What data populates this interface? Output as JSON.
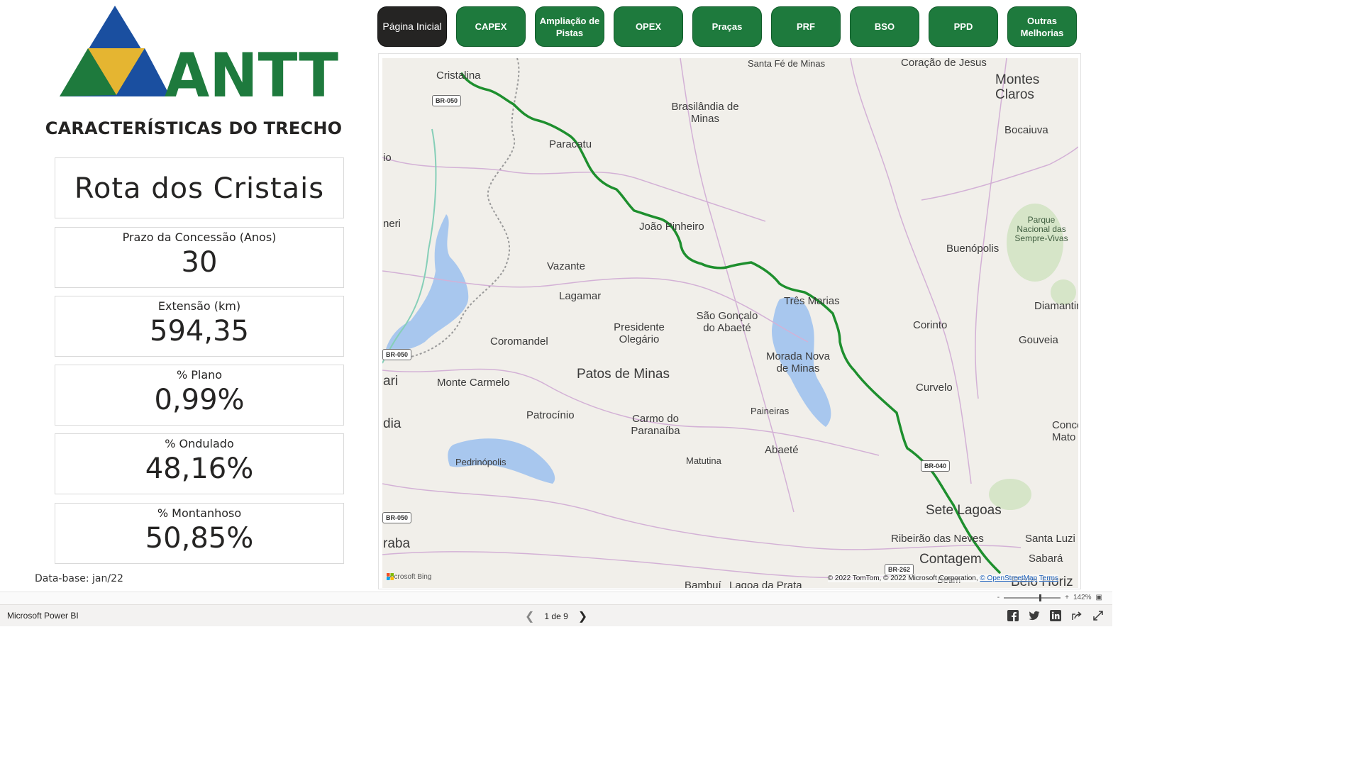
{
  "logo": {
    "text": "ANTT",
    "colors": {
      "blue": "#1a4fa0",
      "yellow": "#e5b531",
      "green": "#1e7a3d"
    }
  },
  "section_title": "CARACTERÍSTICAS DO TRECHO",
  "concession_name": "Rota dos Cristais",
  "kpis": [
    {
      "label": "Prazo da Concessão (Anos)",
      "value": "30"
    },
    {
      "label": "Extensão (km)",
      "value": "594,35"
    },
    {
      "label": "% Plano",
      "value": "0,99%"
    },
    {
      "label": "% Ondulado",
      "value": "48,16%"
    },
    {
      "label": "% Montanhoso",
      "value": "50,85%"
    }
  ],
  "data_base": "Data-base: jan/22",
  "nav": [
    {
      "label": "Página Inicial",
      "active": true
    },
    {
      "label": "CAPEX"
    },
    {
      "label": "Ampliação de Pistas"
    },
    {
      "label": "OPEX"
    },
    {
      "label": "Praças"
    },
    {
      "label": "PRF"
    },
    {
      "label": "BSO"
    },
    {
      "label": "PPD"
    },
    {
      "label": "Outras Melhorias"
    }
  ],
  "map": {
    "cities": {
      "cristalina": "Cristalina",
      "santa_fe": "Santa Fé de Minas",
      "coracao": "Coração de Jesus",
      "montes_claros": "Montes Claros",
      "brasilandia": "Brasilândia de Minas",
      "paracatu": "Paracatu",
      "bocaiuva": "Bocaiuva",
      "io": "io",
      "neri": "neri",
      "joao_pinheiro": "João Pinheiro",
      "buenopolis": "Buenópolis",
      "vazante": "Vazante",
      "lagamar": "Lagamar",
      "tres_marias": "Três Marias",
      "diamantina": "Diamantin",
      "sao_goncalo": "São Gonçalo do Abaeté",
      "presidente": "Presidente Olegário",
      "coromandel": "Coromandel",
      "corinto": "Corinto",
      "gouveia": "Gouveia",
      "morada_nova": "Morada Nova de Minas",
      "patos": "Patos de Minas",
      "ari": "ari",
      "monte_carmelo": "Monte Carmelo",
      "curvelo": "Curvelo",
      "paineiras": "Paineiras",
      "patrocinio": "Patrocínio",
      "carmo": "Carmo do Paranaíba",
      "dia": "dia",
      "conc": "Conce Mato",
      "abaete": "Abaeté",
      "pedrinopolis": "Pedrinópolis",
      "matutina": "Matutina",
      "sete_lagoas": "Sete Lagoas",
      "ribeirao": "Ribeirão das Neves",
      "santa_luzia": "Santa Luzi",
      "raba": "raba",
      "contagem": "Contagem",
      "sabara": "Sabará",
      "bambui": "Bambuí",
      "lagoa_prata": "Lagoa da Prata",
      "belo_horiz": "Belo Horiz",
      "betim": "Betim"
    },
    "park": "Parque Nacional das Sempre-Vivas",
    "shields": [
      "BR-050",
      "BR-050",
      "BR-050",
      "BR-040",
      "BR-262"
    ],
    "provider": "Microsoft Bing",
    "attribution": "© 2022 TomTom, © 2022 Microsoft Corporation,",
    "attribution_link": "© OpenStreetMap",
    "terms": "Terms",
    "route_color": "#1e8f2e"
  },
  "zoom": {
    "minus": "-",
    "plus": "+",
    "level": "142%"
  },
  "footer": {
    "app_name": "Microsoft Power BI",
    "page_indicator": "1 de 9"
  }
}
